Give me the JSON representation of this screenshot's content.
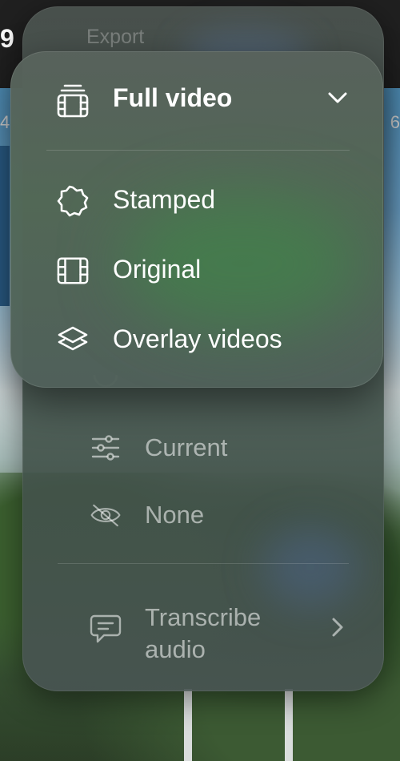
{
  "status_bar": {
    "corner_text": "9"
  },
  "video": {
    "timecode_left": "4",
    "timecode_right": "6"
  },
  "back_menu": {
    "title": "Export",
    "items": [
      {
        "label": "Current",
        "icon": "sliders-icon"
      },
      {
        "label": "None",
        "icon": "eye-slash-icon"
      }
    ],
    "transcribe": {
      "label_line1": "Transcribe",
      "label_line2": "audio",
      "icon": "speech-bubble-icon"
    }
  },
  "front_menu": {
    "selected": "Full video",
    "selected_icon": "film-stack-icon",
    "options": [
      {
        "label": "Stamped",
        "icon": "seal-icon"
      },
      {
        "label": "Original",
        "icon": "film-icon"
      },
      {
        "label": "Overlay videos",
        "icon": "layers-icon"
      }
    ]
  },
  "colors": {
    "text_primary": "#ffffff",
    "text_dimmed": "rgba(255,255,255,0.55)"
  }
}
